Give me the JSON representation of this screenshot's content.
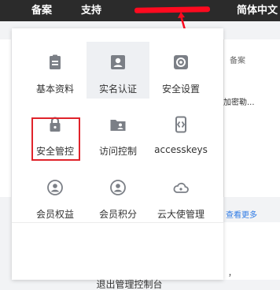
{
  "topbar": {
    "nav_beian": "备案",
    "nav_support": "支持",
    "nav_language": "简体中文"
  },
  "background": {
    "beian": "备案",
    "add_text": "加密勒...",
    "more_link": "查看更多",
    "comma": "，"
  },
  "menu": {
    "items": [
      {
        "label": "基本资料",
        "icon": "id-card-icon"
      },
      {
        "label": "实名认证",
        "icon": "user-verify-icon"
      },
      {
        "label": "安全设置",
        "icon": "gear-icon"
      },
      {
        "label": "安全管控",
        "icon": "lock-icon"
      },
      {
        "label": "访问控制",
        "icon": "folder-user-icon"
      },
      {
        "label": "accesskeys",
        "icon": "key-phone-icon"
      },
      {
        "label": "会员权益",
        "icon": "member-icon"
      },
      {
        "label": "会员积分",
        "icon": "points-icon"
      },
      {
        "label": "云大使管理",
        "icon": "cloud-icon"
      }
    ],
    "logout": "退出管理控制台"
  },
  "colors": {
    "topbar_bg": "#2b2b2b",
    "icon_gray": "#7b7f86",
    "annotation_red": "#e0232b",
    "link_blue": "#2f7be5"
  }
}
